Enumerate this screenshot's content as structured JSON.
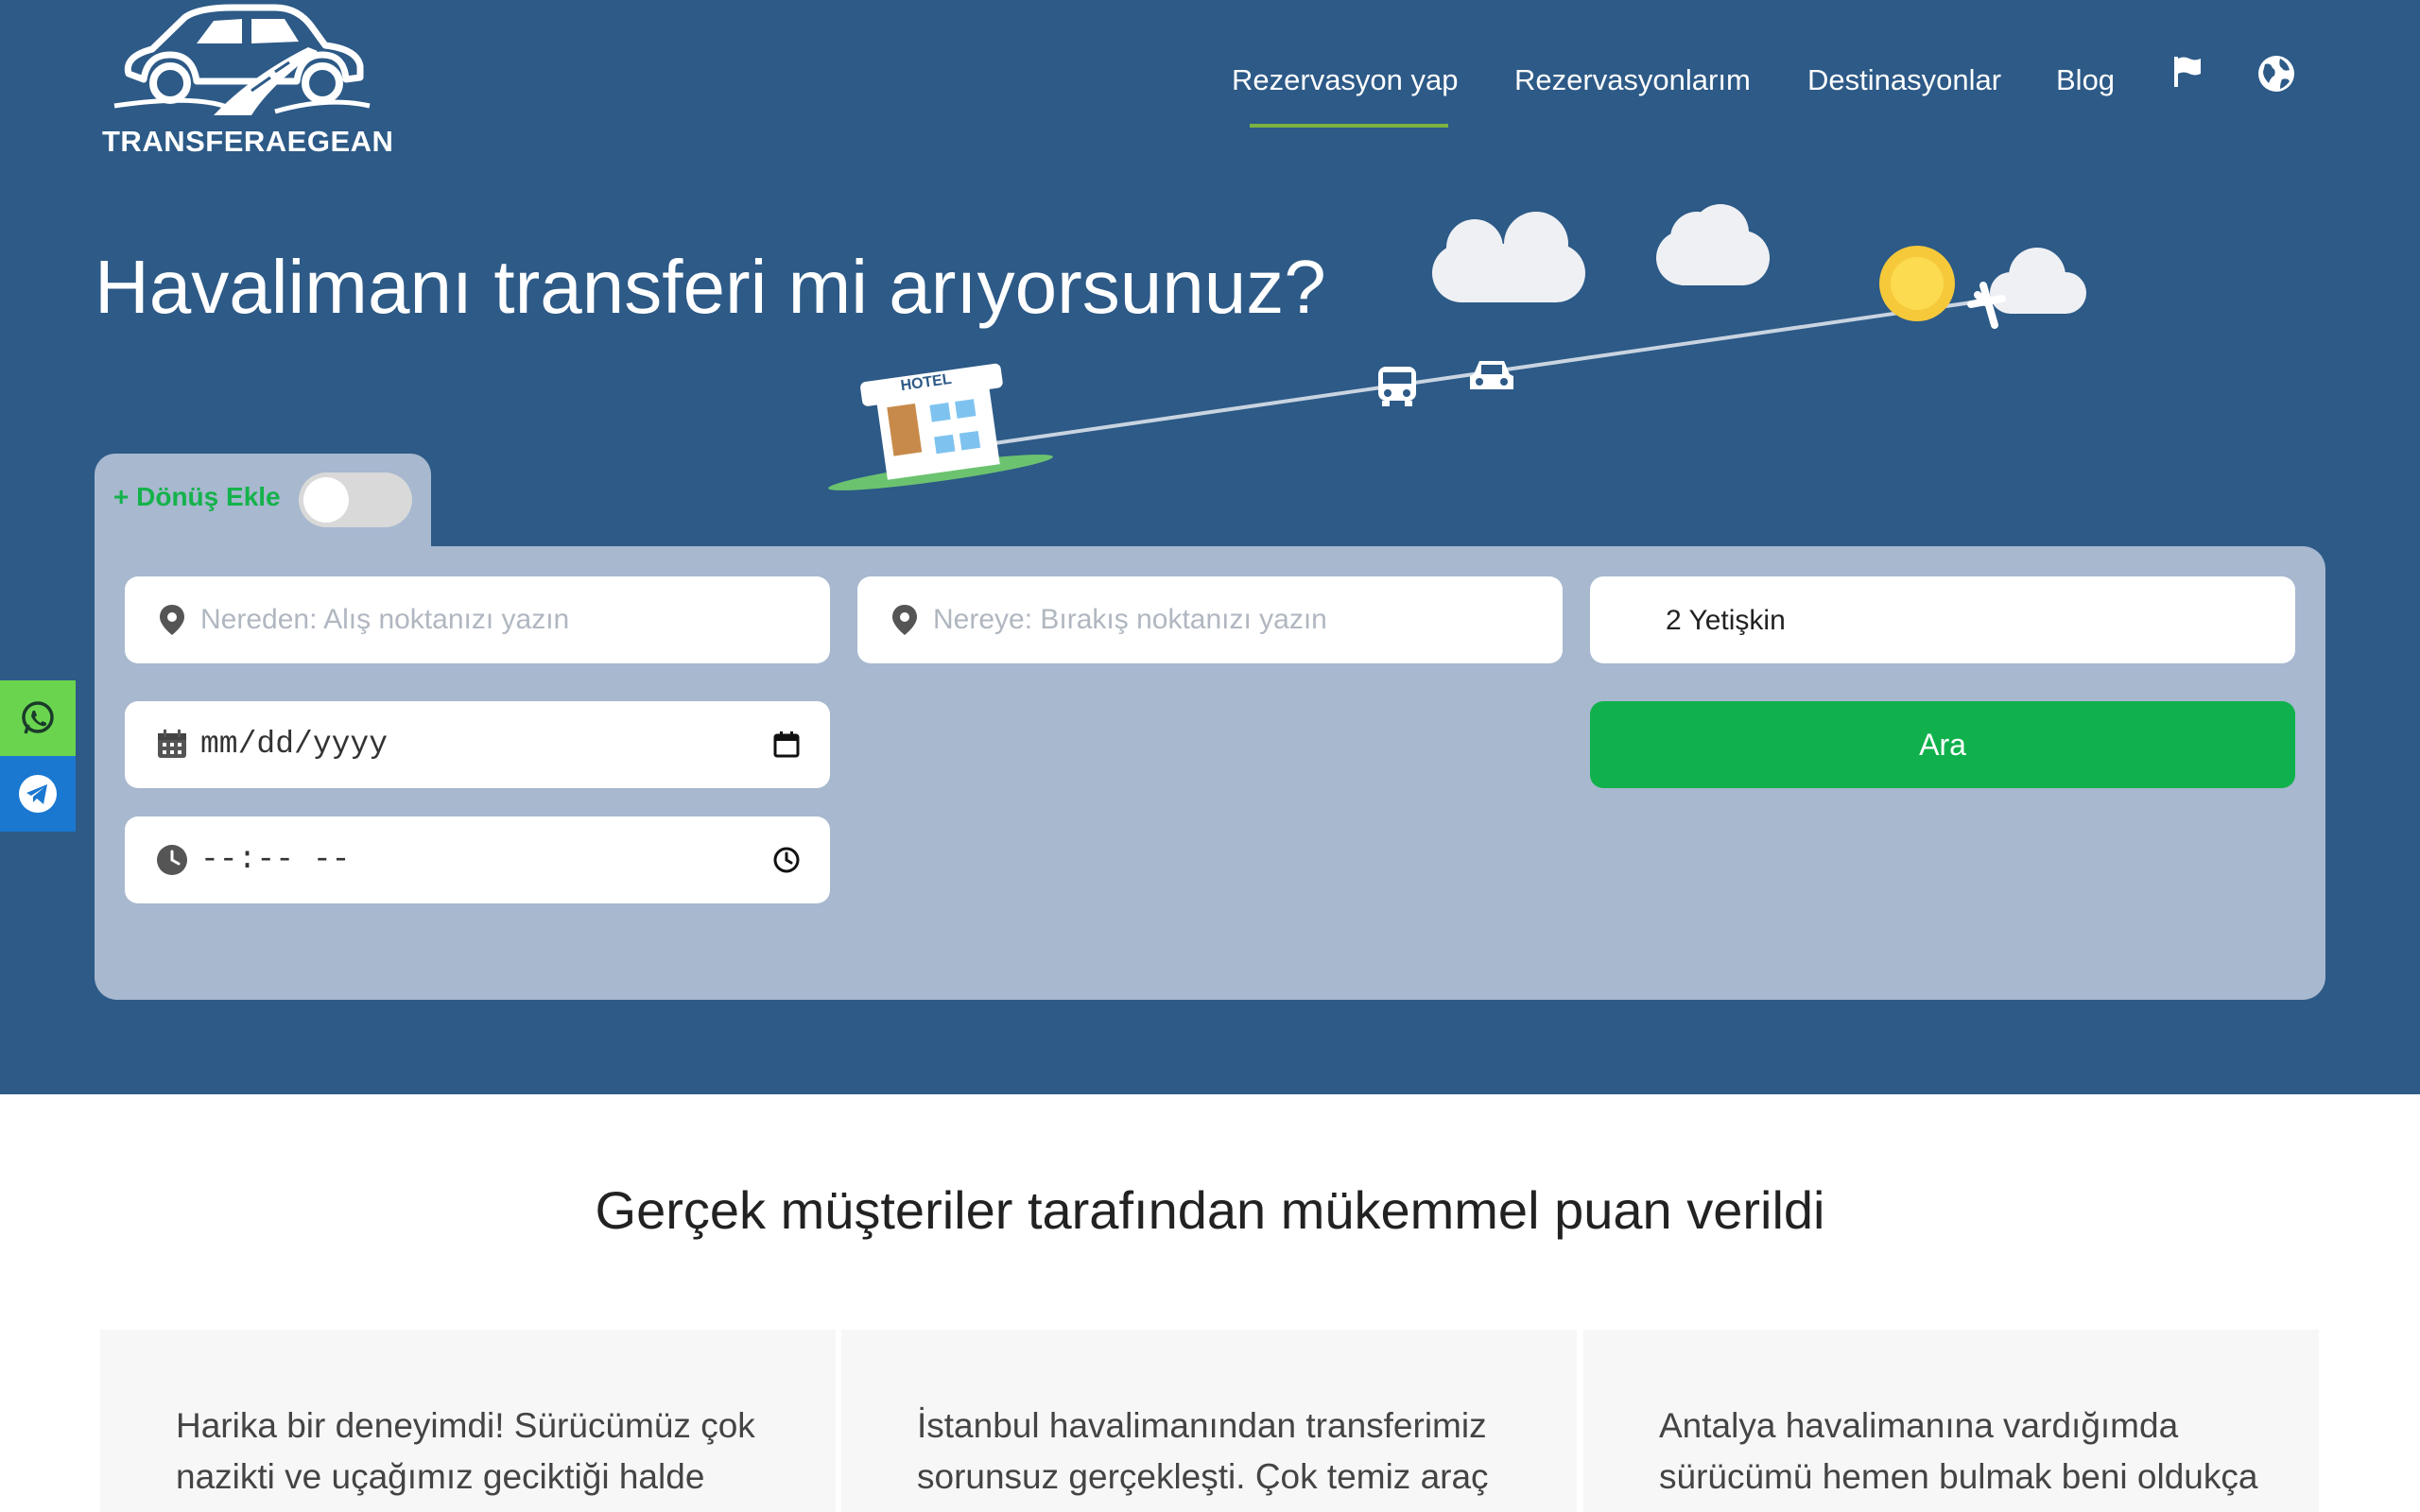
{
  "brand": {
    "name": "TRANSFERAEGEAN"
  },
  "nav": {
    "items": [
      {
        "label": "Rezervasyon yap"
      },
      {
        "label": "Rezervasyonlarım"
      },
      {
        "label": "Destinasyonlar"
      },
      {
        "label": "Blog"
      }
    ],
    "flag_icon": "flag-icon",
    "language_icon": "globe-icon",
    "active_indicator_color": "#7cb342"
  },
  "hero": {
    "title": "Havalimanı transferi mi arıyorsunuz?",
    "illustration": {
      "hotel_label": "HOTEL"
    },
    "background_color": "#2d5a87"
  },
  "booking_form": {
    "return_toggle": {
      "label": "+ Dönüş Ekle",
      "checked": false
    },
    "from": {
      "placeholder": "Nereden: Alış noktanızı yazın",
      "icon": "map-pin-icon"
    },
    "to": {
      "placeholder": "Nereye: Bırakış noktanızı yazın",
      "icon": "map-pin-icon"
    },
    "passengers": {
      "value": "2 Yetişkin"
    },
    "date": {
      "placeholder": "mm/dd/yyyy",
      "icon": "calendar-icon"
    },
    "time": {
      "placeholder": "--:-- --",
      "icon": "clock-icon"
    },
    "search_label": "Ara",
    "accent_color": "#10b14c"
  },
  "side_contacts": [
    {
      "icon": "whatsapp-icon",
      "color": "#6ad44f"
    },
    {
      "icon": "telegram-icon",
      "color": "#1a78d1"
    }
  ],
  "reviews": {
    "title": "Gerçek müşteriler tarafından mükemmel puan verildi",
    "items": [
      {
        "text": "Harika bir deneyimdi! Sürücümüz çok nazikti ve uçağımız geciktiği halde"
      },
      {
        "text": "İstanbul havalimanından transferimiz sorunsuz gerçekleşti. Çok temiz araç"
      },
      {
        "text": "Antalya havalimanına vardığımda sürücümü hemen bulmak beni oldukça"
      }
    ]
  }
}
